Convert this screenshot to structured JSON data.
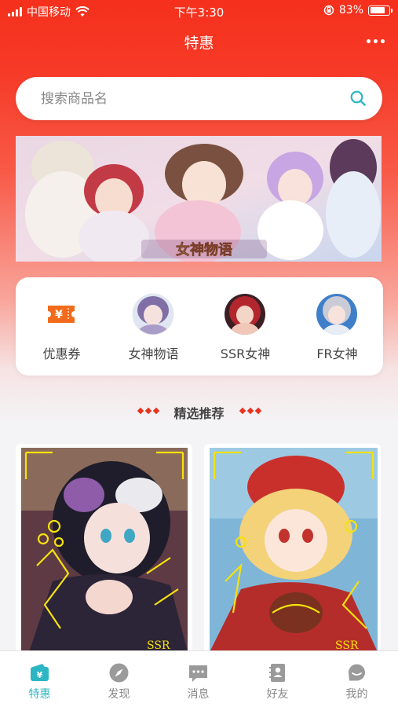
{
  "status_bar": {
    "carrier": "中国移动",
    "time": "下午3:30",
    "battery_percent": "83%",
    "battery_level": 0.83
  },
  "nav": {
    "title": "特惠",
    "more_icon": "more-dots-icon"
  },
  "search": {
    "placeholder": "搜索商品名",
    "value": "",
    "icon": "search-icon"
  },
  "banner": {
    "logo_text": "女神物语"
  },
  "categories": [
    {
      "label": "优惠券",
      "icon": "coupon-icon"
    },
    {
      "label": "女神物语",
      "icon": "avatar-icon"
    },
    {
      "label": "SSR女神",
      "icon": "avatar-icon"
    },
    {
      "label": "FR女神",
      "icon": "avatar-icon"
    }
  ],
  "section": {
    "title": "精选推荐"
  },
  "products": [
    {
      "badge": "SSR"
    },
    {
      "badge": "SSR"
    }
  ],
  "tabs": [
    {
      "label": "特惠",
      "icon": "wallet-icon",
      "active": true
    },
    {
      "label": "发现",
      "icon": "compass-icon",
      "active": false
    },
    {
      "label": "消息",
      "icon": "chat-icon",
      "active": false
    },
    {
      "label": "好友",
      "icon": "contacts-icon",
      "active": false
    },
    {
      "label": "我的",
      "icon": "profile-icon",
      "active": false
    }
  ],
  "colors": {
    "brand_red": "#f5301c",
    "tab_active": "#2cb5c2",
    "coupon_orange": "#f26b1d"
  }
}
